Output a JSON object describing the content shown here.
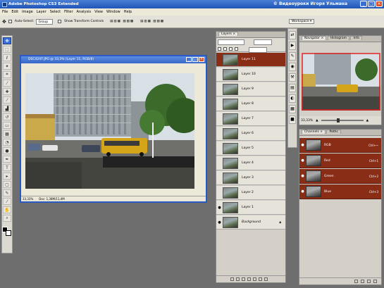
{
  "app": {
    "title": "Adobe Photoshop CS3 Extended",
    "overlay_text": "© Видеоуроки Игоря Ульмана"
  },
  "menu": [
    "File",
    "Edit",
    "Image",
    "Layer",
    "Select",
    "Filter",
    "Analysis",
    "View",
    "Window",
    "Help"
  ],
  "options": {
    "auto_select_label": "Auto-Select:",
    "auto_select_value": "Group",
    "transform_label": "Show Transform Controls",
    "workspace_label": "Workspace ▾"
  },
  "document": {
    "title": "DSC4247.JPG @ 33,3% (Layer 11, RGB/8)",
    "zoom": "33,33%",
    "doc_info": "Doc: 1,38M/11,4M"
  },
  "layers_panel": {
    "tab": "Layers ×",
    "layers": [
      {
        "name": "Layer 11",
        "visible": false,
        "selected": true
      },
      {
        "name": "Layer 10",
        "visible": false,
        "selected": false
      },
      {
        "name": "Layer 9",
        "visible": false,
        "selected": false
      },
      {
        "name": "Layer 8",
        "visible": false,
        "selected": false
      },
      {
        "name": "Layer 7",
        "visible": false,
        "selected": false
      },
      {
        "name": "Layer 6",
        "visible": false,
        "selected": false
      },
      {
        "name": "Layer 5",
        "visible": false,
        "selected": false
      },
      {
        "name": "Layer 4",
        "visible": false,
        "selected": false
      },
      {
        "name": "Layer 3",
        "visible": false,
        "selected": false
      },
      {
        "name": "Layer 2",
        "visible": false,
        "selected": false
      },
      {
        "name": "Layer 1",
        "visible": true,
        "selected": false
      },
      {
        "name": "Background",
        "visible": true,
        "selected": false
      }
    ]
  },
  "navigator": {
    "tabs": [
      "Navigator ×",
      "Histogram",
      "Info"
    ],
    "zoom": "33,33%"
  },
  "channels": {
    "tabs": [
      "Channels ×",
      "Paths"
    ],
    "items": [
      {
        "name": "RGB",
        "shortcut": "Ctrl+~"
      },
      {
        "name": "Red",
        "shortcut": "Ctrl+1"
      },
      {
        "name": "Green",
        "shortcut": "Ctrl+2"
      },
      {
        "name": "Blue",
        "shortcut": "Ctrl+3"
      }
    ]
  },
  "colors": {
    "selection_accent": "#8a2d17",
    "titlebar": "#2a5bc4"
  }
}
